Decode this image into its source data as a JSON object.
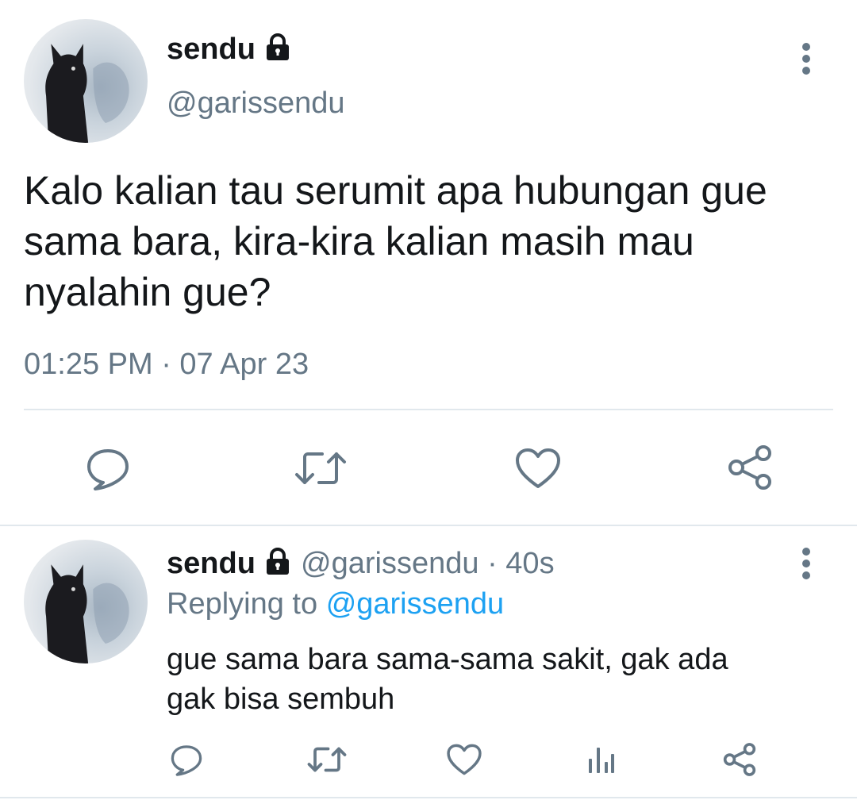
{
  "main_tweet": {
    "display_name": "sendu",
    "handle": "@garissendu",
    "text_lines": [
      "Kalo kalian tau serumit apa hubungan gue",
      "sama bara, kira-kira kalian masih mau",
      "nyalahin gue?"
    ],
    "timestamp": "01:25 PM · 07 Apr 23"
  },
  "reply_tweet": {
    "display_name": "sendu",
    "handle": "@garissendu",
    "separator": "·",
    "age": "40s",
    "replying_prefix": "Replying to",
    "replying_handle": "@garissendu",
    "text_lines": [
      "gue sama bara sama-sama sakit, gak ada",
      "gak bisa sembuh"
    ]
  },
  "icons": {
    "lock": "lock-icon",
    "more": "more-vertical-icon",
    "reply": "comment-icon",
    "retweet": "retweet-icon",
    "like": "heart-icon",
    "share": "share-icon",
    "analytics": "analytics-icon"
  },
  "colors": {
    "text": "#14171a",
    "muted": "#657786",
    "link": "#1da1f2",
    "icon": "#657786",
    "divider": "#e1e8ed"
  }
}
